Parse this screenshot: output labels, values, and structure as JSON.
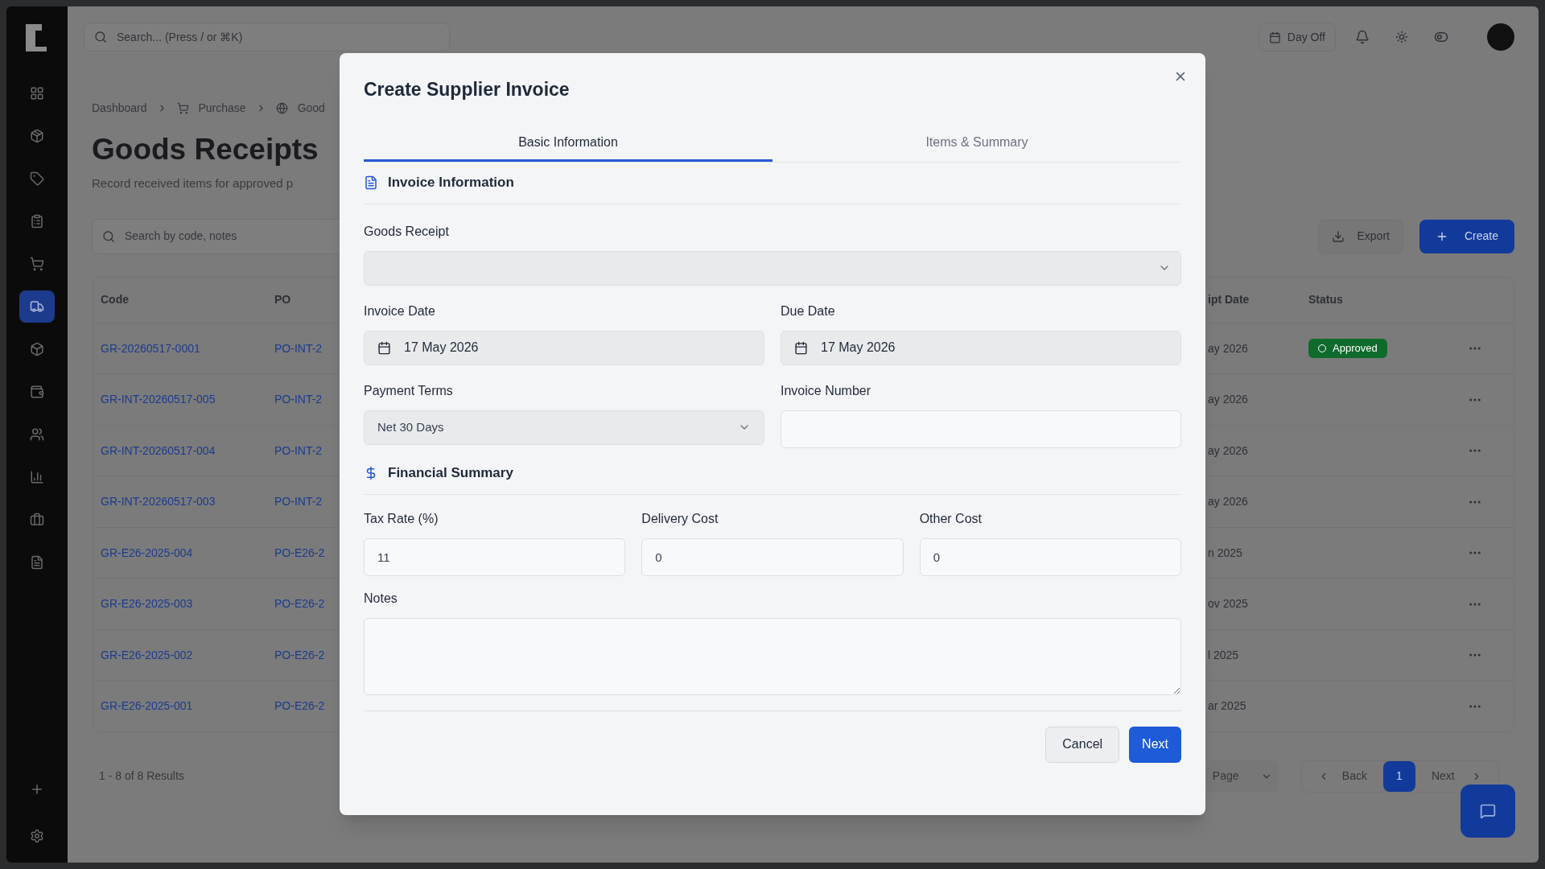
{
  "sidebar": {
    "items": [
      {
        "selected": false
      },
      {
        "selected": false
      },
      {
        "selected": false
      },
      {
        "selected": false
      },
      {
        "selected": false
      },
      {
        "selected": true
      },
      {
        "selected": false
      },
      {
        "selected": false
      },
      {
        "selected": false
      },
      {
        "selected": false
      },
      {
        "selected": false
      },
      {
        "selected": false
      }
    ]
  },
  "topbar": {
    "search_placeholder": "Search... (Press / or ⌘K)",
    "day_off": "Day Off"
  },
  "breadcrumb": [
    "Dashboard",
    "Purchase",
    "Good"
  ],
  "page": {
    "title": "Goods Receipts",
    "subtitle": "Record received items for approved p",
    "search_placeholder": "Search by code, notes",
    "export": "Export",
    "create": "Create"
  },
  "table": {
    "columns": [
      "Code",
      "PO",
      "ipt Date",
      "Status"
    ],
    "rows": [
      {
        "code": "GR-20260517-0001",
        "po": "PO-INT-2",
        "date": "ay 2026",
        "status": "Approved"
      },
      {
        "code": "GR-INT-20260517-005",
        "po": "PO-INT-2",
        "date": "ay 2026"
      },
      {
        "code": "GR-INT-20260517-004",
        "po": "PO-INT-2",
        "date": "ay 2026"
      },
      {
        "code": "GR-INT-20260517-003",
        "po": "PO-INT-2",
        "date": "ay 2026"
      },
      {
        "code": "GR-E26-2025-004",
        "po": "PO-E26-2",
        "date": "n 2025"
      },
      {
        "code": "GR-E26-2025-003",
        "po": "PO-E26-2",
        "date": "ov 2025"
      },
      {
        "code": "GR-E26-2025-002",
        "po": "PO-E26-2",
        "date": "l 2025"
      },
      {
        "code": "GR-E26-2025-001",
        "po": "PO-E26-2",
        "date": "ar 2025"
      }
    ]
  },
  "footer": {
    "results": "1 - 8 of 8 Results",
    "page_select": "Page",
    "back": "Back",
    "pages": [
      {
        "label": "1",
        "selected": true
      }
    ],
    "next": "Next"
  },
  "modal": {
    "title": "Create Supplier Invoice",
    "tabs": [
      {
        "label": "Basic Information",
        "selected": true
      },
      {
        "label": "Items & Summary",
        "selected": false
      }
    ],
    "sections": [
      {
        "kind": "file",
        "title": "Invoice Information"
      },
      {
        "kind": "money",
        "title": "Financial Summary"
      }
    ],
    "goods_receipt": {
      "label": "Goods Receipt"
    },
    "invoice_date": {
      "label": "Invoice Date",
      "value": "17 May 2026"
    },
    "due_date": {
      "label": "Due Date",
      "value": "17 May 2026"
    },
    "payment_terms": {
      "label": "Payment Terms",
      "value": "Net 30 Days"
    },
    "invoice_number": {
      "label": "Invoice Number"
    },
    "costs": [
      {
        "label": "Tax Rate (%)",
        "value": "11"
      },
      {
        "label": "Delivery Cost",
        "value": "0"
      },
      {
        "label": "Other Cost",
        "value": "0"
      }
    ],
    "notes": {
      "label": "Notes"
    },
    "buttons": [
      {
        "kind": "secondary",
        "label": "Cancel"
      },
      {
        "kind": "primary",
        "label": "Next"
      }
    ]
  }
}
